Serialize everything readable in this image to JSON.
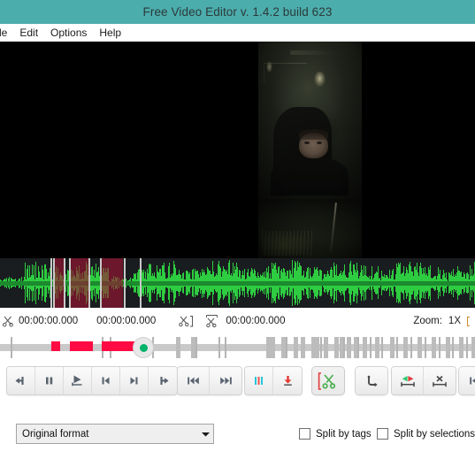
{
  "window": {
    "title": "Free Video Editor v. 1.4.2 build 623",
    "titlebar_color": "#4cadad"
  },
  "menu": {
    "items": [
      {
        "label": "File",
        "clipped": true
      },
      {
        "label": "Edit",
        "clipped": false
      },
      {
        "label": "Options",
        "clipped": false
      },
      {
        "label": "Help",
        "clipped": false
      }
    ]
  },
  "preview": {
    "background": "#000000",
    "description": "dark video frame of a man in a dim room"
  },
  "waveform": {
    "background": "#1a1d20",
    "wave_color": "#2ecc40",
    "selection_color": "#a01432",
    "selection_border_color": "#c8c8c8"
  },
  "timecode_bar": {
    "cut_start_icon": "scissors-icon",
    "start_time": "00:00:00.000",
    "end_time": "00:00:00.000",
    "set_out_icon": "scissors-bracket-icon",
    "split_icon": "scissors-split-icon",
    "current_time": "00:00:00.000",
    "zoom_label": "Zoom:",
    "zoom_value": "1X"
  },
  "track_bar": {
    "playhead_color": "#00b36b",
    "marker_color": "#ff0a42"
  },
  "transport": {
    "groups": [
      {
        "name": "playback-group",
        "buttons": [
          {
            "name": "step-back-button",
            "icon": "arrow-left-icon"
          },
          {
            "name": "pause-button",
            "icon": "pause-icon"
          },
          {
            "name": "play-button",
            "icon": "play-from-start-icon"
          },
          {
            "name": "previous-frame-button",
            "icon": "skip-start-icon"
          },
          {
            "name": "next-frame-button",
            "icon": "skip-end-icon"
          },
          {
            "name": "step-forward-button",
            "icon": "arrow-right-icon"
          }
        ]
      },
      {
        "name": "jump-group",
        "buttons": [
          {
            "name": "jump-to-begin-button",
            "icon": "rewind-start-icon"
          },
          {
            "name": "jump-to-end-button",
            "icon": "fast-forward-end-icon"
          }
        ]
      },
      {
        "name": "marker-group",
        "buttons": [
          {
            "name": "add-tag-button",
            "icon": "three-bars-icon"
          },
          {
            "name": "insert-marker-button",
            "icon": "red-arrow-down-icon"
          }
        ]
      },
      {
        "name": "cut-group",
        "buttons": [
          {
            "name": "cut-selection-button",
            "icon": "green-scissors-bracket-icon"
          }
        ]
      },
      {
        "name": "undo-group",
        "buttons": [
          {
            "name": "undo-button",
            "icon": "arrow-curve-icon"
          }
        ]
      },
      {
        "name": "selection-group",
        "buttons": [
          {
            "name": "select-range-button",
            "icon": "green-red-arrows-icon"
          },
          {
            "name": "delete-range-button",
            "icon": "range-x-icon"
          }
        ]
      },
      {
        "name": "nav-group",
        "buttons": [
          {
            "name": "previous-selection-button",
            "icon": "prev-marker-icon"
          }
        ]
      }
    ]
  },
  "bottom": {
    "format_select": {
      "value": "Original format",
      "arrow_icon": "chevron-down-icon"
    },
    "split_by_tags": {
      "label": "Split by tags",
      "checked": false
    },
    "split_by_selections": {
      "label": "Split by selections",
      "checked": false
    }
  }
}
